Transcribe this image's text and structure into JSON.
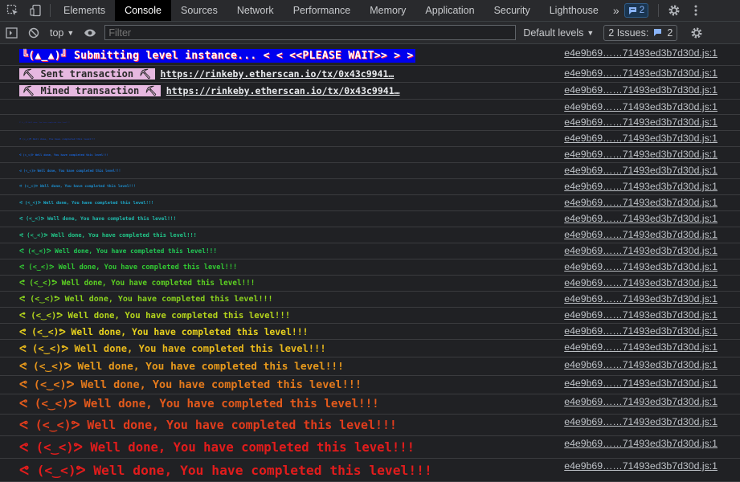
{
  "tabbar": {
    "tabs": [
      "Elements",
      "Console",
      "Sources",
      "Network",
      "Performance",
      "Memory",
      "Application",
      "Security",
      "Lighthouse"
    ],
    "active": "Console",
    "overflow": "»",
    "messages_count": "2"
  },
  "toolbar": {
    "context": "top",
    "filter_placeholder": "Filter",
    "levels": "Default levels",
    "issues_label": "2 Issues:",
    "issues_count": "2"
  },
  "banner": {
    "text": "╚(▲_▲)╝ Submitting level instance...",
    "arrows": "<  < <<PLEASE WAIT>> >  >"
  },
  "sent": {
    "label": "⛏ Sent transaction ⛏",
    "url": "https://rinkeby.etherscan.io/tx/0x43c9941…"
  },
  "mined": {
    "label": "⛏ Mined transaction ⛏",
    "url": "https://rinkeby.etherscan.io/tx/0x43c9941…"
  },
  "well_done": "ᕙ (<‿<)ᕗ Well done, You have completed this level!!!",
  "source": "e4e9b69……71493ed3b7d30d.js:1",
  "colors": {
    "banner_bg": "#0000ee",
    "link_rows_bg": "#e6b8e0",
    "gradient_start": "#1a4fd6",
    "gradient_mid": "#22c955",
    "gradient_yellow": "#e8d21e",
    "gradient_end": "#e21c1c"
  }
}
